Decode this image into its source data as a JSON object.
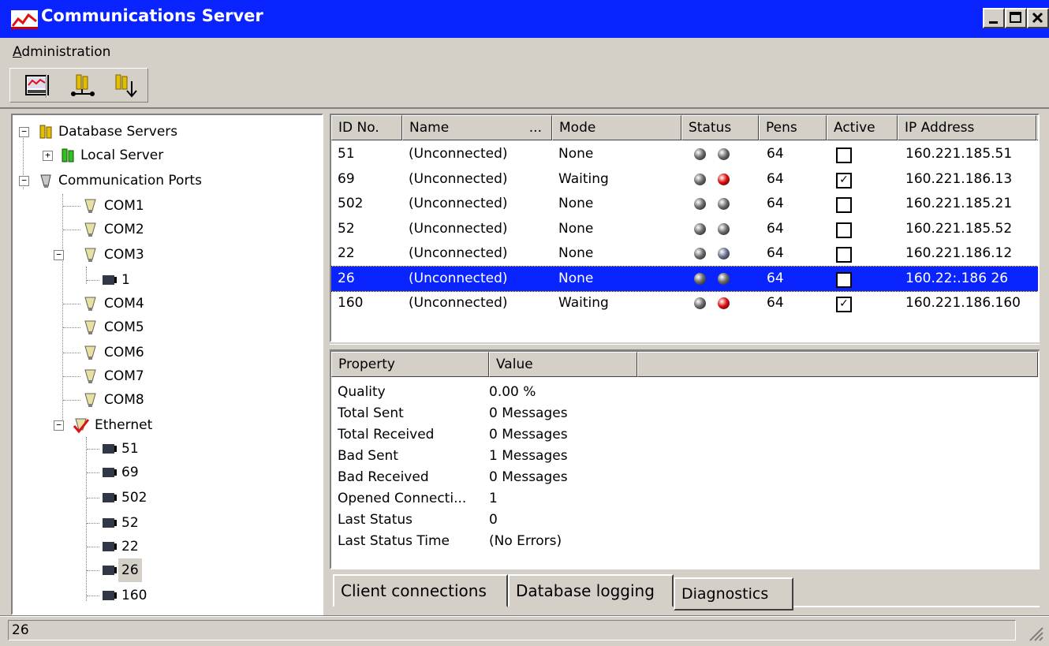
{
  "window": {
    "title": "Communications Server",
    "title_bar_color": "#0a24ff",
    "controls": [
      "minimize",
      "maximize",
      "close"
    ]
  },
  "menu": {
    "items": [
      "Administration"
    ]
  },
  "toolbar": {
    "buttons": [
      "monitor-icon",
      "connect-servers-icon",
      "add-server-icon"
    ]
  },
  "tree": {
    "database_servers": "Database Servers",
    "local_server": "Local Server",
    "communication_ports": "Communication Ports",
    "com1": "COM1",
    "com2": "COM2",
    "com3": "COM3",
    "com3_child": "1",
    "com4": "COM4",
    "com5": "COM5",
    "com6": "COM6",
    "com7": "COM7",
    "com8": "COM8",
    "ethernet": "Ethernet",
    "eth": [
      "51",
      "69",
      "502",
      "52",
      "22",
      "26",
      "160"
    ],
    "selected": "26"
  },
  "listview": {
    "columns": [
      "ID No.",
      "Name",
      "...",
      "Mode",
      "Status",
      "Pens",
      "Active",
      "IP Address"
    ],
    "rows": [
      {
        "id": "51",
        "name": "(Unconnected)",
        "mode": "None",
        "status": [
          "gray",
          "gray"
        ],
        "pens": "64",
        "active": false,
        "ip": "160.221.185.51"
      },
      {
        "id": "69",
        "name": "(Unconnected)",
        "mode": "Waiting",
        "status": [
          "gray",
          "red"
        ],
        "pens": "64",
        "active": true,
        "ip": "160.221.186.13"
      },
      {
        "id": "502",
        "name": "(Unconnected)",
        "mode": "None",
        "status": [
          "gray",
          "gray"
        ],
        "pens": "64",
        "active": false,
        "ip": "160.221.185.21"
      },
      {
        "id": "52",
        "name": "(Unconnected)",
        "mode": "None",
        "status": [
          "gray",
          "gray"
        ],
        "pens": "64",
        "active": false,
        "ip": "160.221.185.52"
      },
      {
        "id": "22",
        "name": "(Unconnected)",
        "mode": "None",
        "status": [
          "gray",
          "blue-gray"
        ],
        "pens": "64",
        "active": false,
        "ip": "160.221.186.12"
      },
      {
        "id": "26",
        "name": "(Unconnected)",
        "mode": "None",
        "status": [
          "gray",
          "gray"
        ],
        "pens": "64",
        "active": false,
        "ip": "160.22:.186 26"
      },
      {
        "id": "160",
        "name": "(Unconnected)",
        "mode": "Waiting",
        "status": [
          "gray",
          "red"
        ],
        "pens": "64",
        "active": true,
        "ip": "160.221.186.160"
      }
    ],
    "selected_row_id": "26"
  },
  "properties": {
    "columns": [
      "Property",
      "Value"
    ],
    "rows": [
      {
        "name": "Quality",
        "value": "0.00 %"
      },
      {
        "name": "Total Sent",
        "value": "0 Messages"
      },
      {
        "name": "Total Received",
        "value": "0 Messages"
      },
      {
        "name": "Bad Sent",
        "value": "1 Messages"
      },
      {
        "name": "Bad Received",
        "value": "0 Messages"
      },
      {
        "name": "Opened Connecti...",
        "value": "1"
      },
      {
        "name": "Last Status",
        "value": "0"
      },
      {
        "name": "Last Status Time",
        "value": "(No Errors)"
      }
    ]
  },
  "tabs": {
    "client": "Client connections",
    "db": "Database logging",
    "diag": "Diagnostics",
    "active": "Diagnostics"
  },
  "statusbar": {
    "text": "26"
  },
  "colors": {
    "led_gray": "#6e6e6e",
    "led_red": "#e01010",
    "led_blue_gray": "#6a7290",
    "selection": "#0a24ff"
  }
}
